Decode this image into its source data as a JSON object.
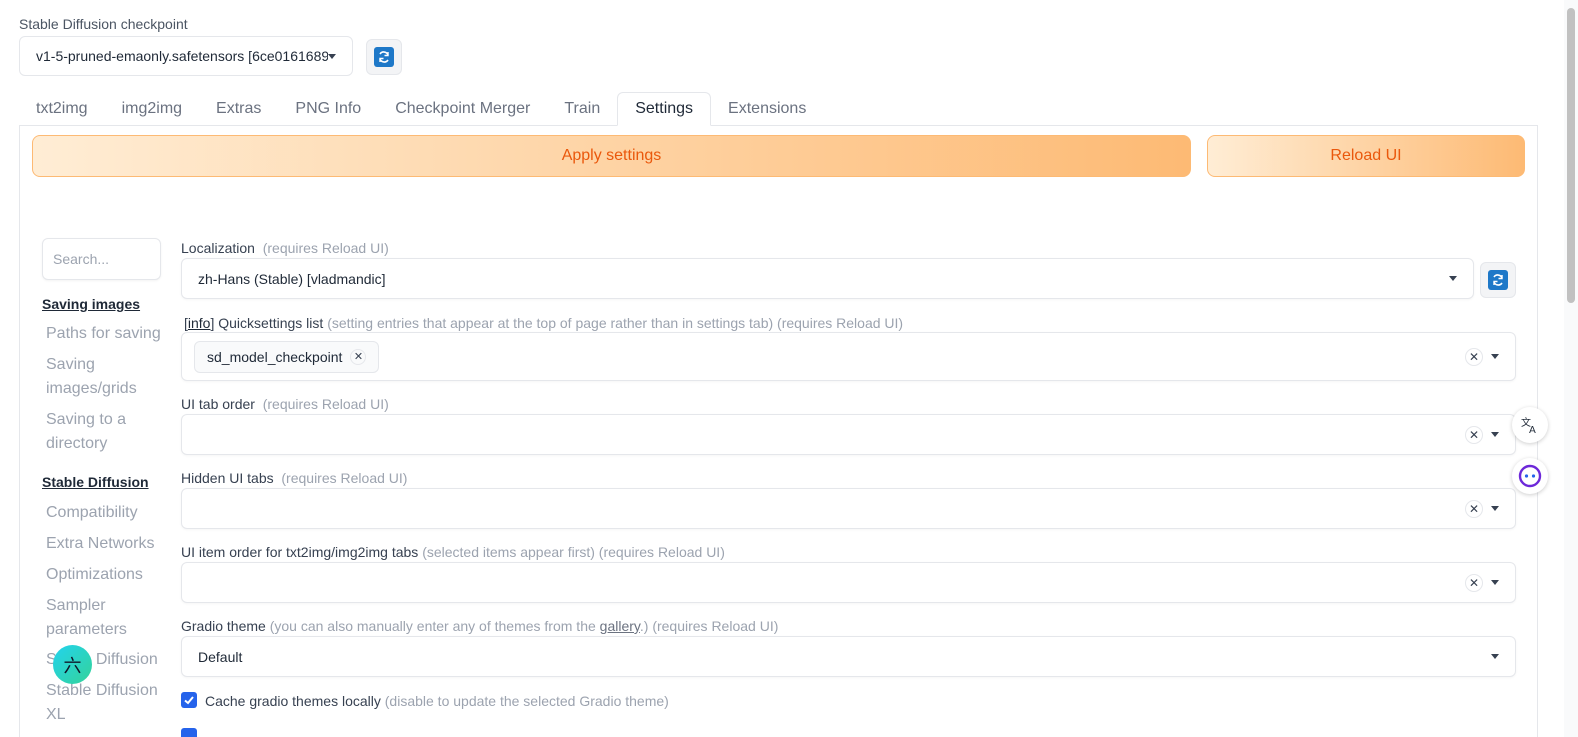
{
  "checkpoint": {
    "label": "Stable Diffusion checkpoint",
    "value": "v1-5-pruned-emaonly.safetensors [6ce0161689]"
  },
  "tabs": [
    {
      "label": "txt2img"
    },
    {
      "label": "img2img"
    },
    {
      "label": "Extras"
    },
    {
      "label": "PNG Info"
    },
    {
      "label": "Checkpoint Merger"
    },
    {
      "label": "Train"
    },
    {
      "label": "Settings"
    },
    {
      "label": "Extensions"
    }
  ],
  "actions": {
    "apply": "Apply settings",
    "reload": "Reload UI"
  },
  "search": {
    "placeholder": "Search..."
  },
  "sidebar": {
    "section1": "Saving images",
    "items1": [
      "Paths for saving",
      "Saving images/grids",
      "Saving to a directory"
    ],
    "section2": "Stable Diffusion",
    "items2": [
      "Compatibility",
      "Extra Networks",
      "Optimizations",
      "Sampler parameters",
      "Stable Diffusion",
      "Stable Diffusion XL"
    ]
  },
  "settings": {
    "localization": {
      "label": "Localization",
      "note": "(requires Reload UI)",
      "value": "zh-Hans (Stable) [vladmandic]"
    },
    "quicksettings": {
      "info": "info",
      "label": "Quicksettings list",
      "note": "(setting entries that appear at the top of page rather than in settings tab) (requires Reload UI)",
      "chip": "sd_model_checkpoint"
    },
    "tab_order": {
      "label": "UI tab order",
      "note": "(requires Reload UI)"
    },
    "hidden_tabs": {
      "label": "Hidden UI tabs",
      "note": "(requires Reload UI)"
    },
    "item_order": {
      "label": "UI item order for txt2img/img2img tabs",
      "note": "(selected items appear first) (requires Reload UI)"
    },
    "gradio_theme": {
      "label": "Gradio theme",
      "note_a": "(you can also manually enter any of themes from the",
      "link": "gallery",
      "note_b": ".) (requires Reload UI)",
      "value": "Default"
    },
    "cache_themes": {
      "label": "Cache gradio themes locally",
      "note": "(disable to update the selected Gradio theme)",
      "checked": true
    }
  },
  "floating": {
    "translate_icon": "translate-icon",
    "assistant_icon": "assistant-icon",
    "badge_char": "六"
  }
}
